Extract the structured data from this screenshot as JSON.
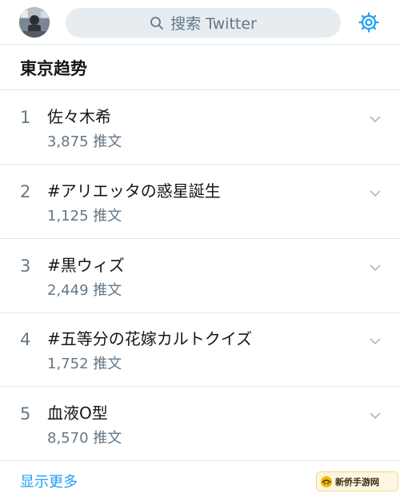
{
  "header": {
    "search_placeholder": "搜索 Twitter"
  },
  "section": {
    "title": "東京趋势"
  },
  "trends": [
    {
      "rank": "1",
      "name": "佐々木希",
      "count": "3,875 推文"
    },
    {
      "rank": "2",
      "name": "#アリエッタの惑星誕生",
      "count": "1,125 推文"
    },
    {
      "rank": "3",
      "name": "#黒ウィズ",
      "count": "2,449 推文"
    },
    {
      "rank": "4",
      "name": "#五等分の花嫁カルトクイズ",
      "count": "1,752 推文"
    },
    {
      "rank": "5",
      "name": "血液O型",
      "count": "8,570 推文"
    }
  ],
  "footer": {
    "show_more": "显示更多"
  },
  "watermark": {
    "text": "新侨手游网"
  },
  "colors": {
    "accent": "#1da1f2",
    "secondary_text": "#657786",
    "divider": "#e1e8ed",
    "search_bg": "#e6ecf0"
  },
  "icons": [
    "avatar",
    "search-icon",
    "gear-icon",
    "chevron-down-icon",
    "watermark-logo-icon"
  ]
}
